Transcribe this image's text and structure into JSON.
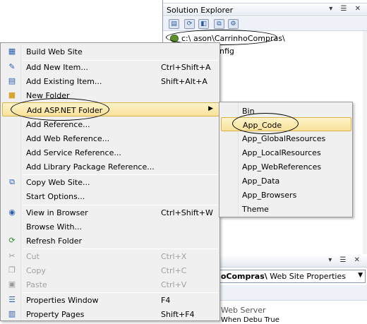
{
  "solution_explorer": {
    "title": "Solution Explorer",
    "title_icons": "▾ ☰ ✕",
    "root_path": "c:\\ ason\\CarrinhoCompras\\",
    "visible_child": "nfig"
  },
  "properties_panel": {
    "combo_bold": "hoCompras\\",
    "combo_rest": " Web Site Properties",
    "category": "Web Server",
    "row_partial": "When Debu  True"
  },
  "context_menu": {
    "items": [
      {
        "label": "Build Web Site",
        "shortcut": "",
        "icon": "build-icon"
      },
      {
        "label": "Add New Item...",
        "shortcut": "Ctrl+Shift+A",
        "icon": "new-item-icon"
      },
      {
        "label": "Add Existing Item...",
        "shortcut": "Shift+Alt+A",
        "icon": "existing-item-icon"
      },
      {
        "label": "New Folder",
        "shortcut": "",
        "icon": "folder-icon"
      },
      {
        "label": "Add ASP.NET Folder",
        "shortcut": "",
        "icon": ""
      },
      {
        "label": "Add Reference...",
        "shortcut": "",
        "icon": ""
      },
      {
        "label": "Add Web Reference...",
        "shortcut": "",
        "icon": ""
      },
      {
        "label": "Add Service Reference...",
        "shortcut": "",
        "icon": ""
      },
      {
        "label": "Add Library Package Reference...",
        "shortcut": "",
        "icon": ""
      },
      {
        "label": "Copy Web Site...",
        "shortcut": "",
        "icon": "copy-site-icon"
      },
      {
        "label": "Start Options...",
        "shortcut": "",
        "icon": ""
      },
      {
        "label": "View in Browser",
        "shortcut": "Ctrl+Shift+W",
        "icon": "browser-icon"
      },
      {
        "label": "Browse With...",
        "shortcut": "",
        "icon": ""
      },
      {
        "label": "Refresh Folder",
        "shortcut": "",
        "icon": "refresh-icon"
      },
      {
        "label": "Cut",
        "shortcut": "Ctrl+X",
        "icon": "cut-icon"
      },
      {
        "label": "Copy",
        "shortcut": "Ctrl+C",
        "icon": "copy-icon"
      },
      {
        "label": "Paste",
        "shortcut": "Ctrl+V",
        "icon": "paste-icon"
      },
      {
        "label": "Properties Window",
        "shortcut": "F4",
        "icon": "properties-icon"
      },
      {
        "label": "Property Pages",
        "shortcut": "Shift+F4",
        "icon": "property-pages-icon"
      }
    ]
  },
  "submenu": {
    "items": [
      "Bin",
      "App_Code",
      "App_GlobalResources",
      "App_LocalResources",
      "App_WebReferences",
      "App_Data",
      "App_Browsers",
      "Theme"
    ]
  },
  "colors": {
    "highlight": "#f9e29a",
    "menu_background": "#f0f0f0",
    "disabled_text": "#a0a0a0"
  }
}
